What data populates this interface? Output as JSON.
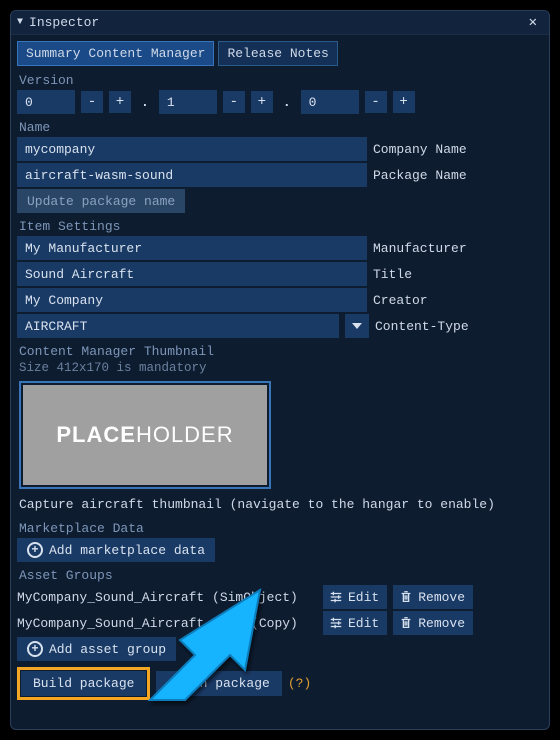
{
  "window": {
    "title": "Inspector"
  },
  "tabs": {
    "active": "Summary Content Manager",
    "other": "Release Notes"
  },
  "version": {
    "label": "Version",
    "major": "0",
    "minor": "1",
    "patch": "0"
  },
  "name": {
    "label": "Name",
    "company": {
      "value": "mycompany",
      "label": "Company Name"
    },
    "package": {
      "value": "aircraft-wasm-sound",
      "label": "Package Name"
    },
    "update_btn": "Update package name"
  },
  "item": {
    "label": "Item Settings",
    "manufacturer": {
      "value": "My Manufacturer",
      "label": "Manufacturer"
    },
    "title": {
      "value": "Sound Aircraft",
      "label": "Title"
    },
    "creator": {
      "value": "My Company",
      "label": "Creator"
    },
    "content_type": {
      "value": "AIRCRAFT",
      "label": "Content-Type"
    }
  },
  "thumbnail": {
    "label": "Content Manager Thumbnail",
    "hint": "Size 412x170 is mandatory",
    "placeholder_bold": "PLACE",
    "placeholder_thin": "HOLDER",
    "caption": "Capture aircraft thumbnail (navigate to the hangar to enable)"
  },
  "marketplace": {
    "label": "Marketplace Data",
    "add_btn": "Add marketplace data"
  },
  "assets": {
    "label": "Asset Groups",
    "rows": [
      {
        "name": "MyCompany_Sound_Aircraft (SimObject)"
      },
      {
        "name": "MyCompany_Sound_Aircraft_Data (Copy)"
      }
    ],
    "edit": "Edit",
    "remove": "Remove",
    "add_btn": "Add asset group"
  },
  "footer": {
    "build": "Build package",
    "clean": "Clean package",
    "help": "(?)"
  }
}
